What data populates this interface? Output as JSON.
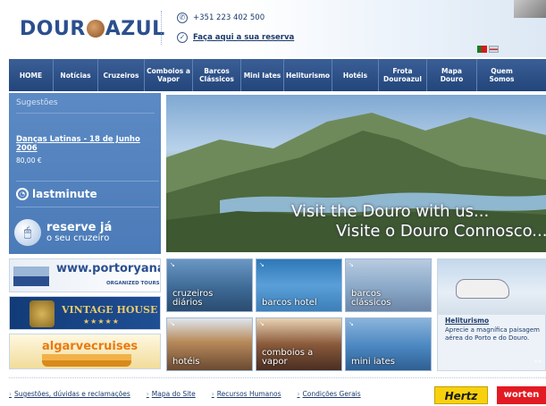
{
  "header": {
    "logo_text_left": "DOUR",
    "logo_text_right": "AZUL",
    "phone": "+351 223 402 500",
    "reserve_link": "Faça aqui a sua reserva",
    "icons": {
      "phone": "phone-icon",
      "reserve": "check-circle-icon"
    }
  },
  "nav": {
    "items": [
      {
        "label": "HOME"
      },
      {
        "label": "Notícias"
      },
      {
        "label": "Cruzeiros"
      },
      {
        "label": "Comboios a Vapor"
      },
      {
        "label": "Barcos Clássicos"
      },
      {
        "label": "Mini Iates"
      },
      {
        "label": "Heliturismo"
      },
      {
        "label": "Hotéis"
      },
      {
        "label": "Frota Douroazul"
      },
      {
        "label": "Mapa Douro"
      },
      {
        "label": "Quem Somos"
      }
    ]
  },
  "sidebar": {
    "title": "Sugestões",
    "event": "Danças Latinas - 18 de Junho 2006",
    "price": "80,00 €",
    "lastminute": "lastminute",
    "reserve_line1": "reserve já",
    "reserve_line2": "o seu cruzeiro"
  },
  "hero": {
    "line1": "Visit the Douro with us...",
    "line2": "Visite o Douro Connosco..."
  },
  "partners": {
    "porto": {
      "logo": "www.portoryanair.com",
      "sub": "ORGANIZED TOURS"
    },
    "vintage": {
      "name": "VINTAGE HOUSE",
      "stars": "★★★★★"
    },
    "algarve": {
      "name": "algarvecruises"
    }
  },
  "tiles": {
    "cruzeiros": "cruzeiros diários",
    "barcos_hotel": "barcos hotel",
    "classicos": "barcos clássicos",
    "hoteis": "hotéis",
    "comboios": "comboios a vapor",
    "mini_iates": "mini iates"
  },
  "heli": {
    "title": "Heliturismo",
    "desc": "Aprecie a magnífica paisagem aérea do Porto e do Douro.",
    "more": "»»"
  },
  "footer": {
    "links": [
      "Sugestões, dúvidas e reclamações",
      "Mapa do Site",
      "Recursos Humanos",
      "Condições Gerais"
    ],
    "arrow": "›",
    "hertz": "Hertz",
    "worten": "worten"
  }
}
